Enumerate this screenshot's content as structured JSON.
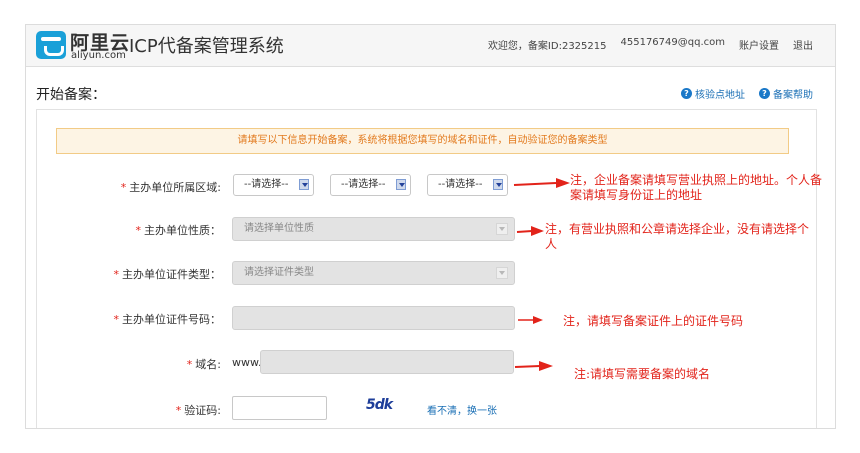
{
  "header": {
    "logo_cn": "阿里云",
    "logo_en": "aliyun.com",
    "title": "ICP代备案管理系统",
    "welcome": "欢迎您，备案ID:2325215",
    "email": "455176749@qq.com",
    "account_settings": "账户设置",
    "logout": "退出"
  },
  "subbar": {
    "title": "开始备案：",
    "verify_link": "核验点地址",
    "help_link": "备案帮助"
  },
  "notice": "请填写以下信息开始备案，系统将根据您填写的域名和证件，自动验证您的备案类型",
  "form": {
    "region": {
      "label": "主办单位所属区域:",
      "select1": "--请选择--",
      "select2": "--请选择--",
      "select3": "--请选择--"
    },
    "nature": {
      "label": "主办单位性质：",
      "placeholder": "请选择单位性质"
    },
    "cert_type": {
      "label": "主办单位证件类型：",
      "placeholder": "请选择证件类型"
    },
    "cert_number": {
      "label": "主办单位证件号码：",
      "value": ""
    },
    "domain": {
      "label": "域名:",
      "prefix": "www.",
      "value": ""
    },
    "captcha": {
      "label": "验证码:",
      "value": "",
      "image_text": "5dk",
      "refresh": "看不清，换一张"
    }
  },
  "notes": {
    "region_line1": "注，企业备案请填写营业执照上的地址。个人备",
    "region_line2": "案请填写身份证上的地址",
    "nature_line1": "注，有营业执照和公章请选择企业，没有请选择个",
    "nature_line2": "人",
    "cert_number": "注，请填写备案证件上的证件号码",
    "domain": "注:请填写需要备案的域名"
  },
  "colors": {
    "accent": "#1a78c8",
    "note_red": "#e2231a",
    "notice_orange": "#e27a1e"
  }
}
